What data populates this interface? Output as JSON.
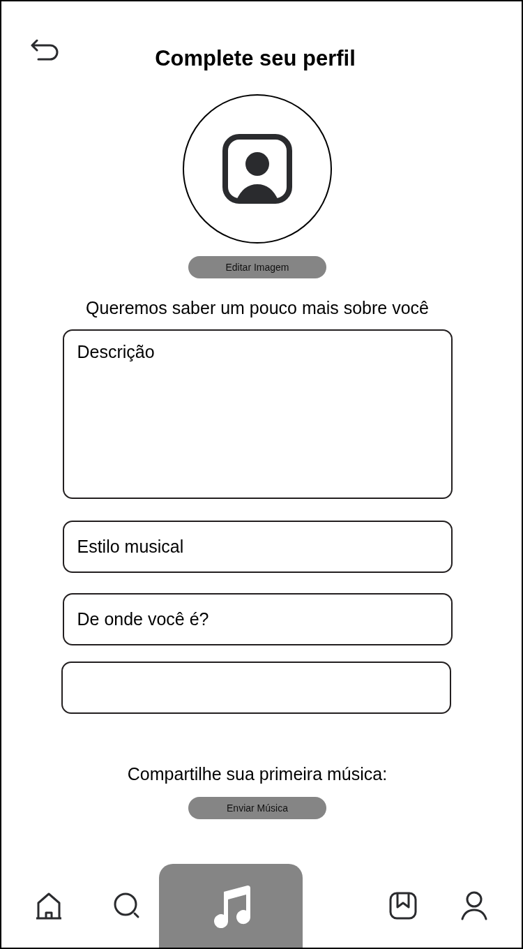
{
  "header": {
    "title": "Complete seu perfil"
  },
  "avatar": {
    "button": "Editar Imagem"
  },
  "intro": "Queremos saber um pouco mais sobre você",
  "fields": [
    {
      "kind": "textarea",
      "placeholder": "Descrição"
    },
    {
      "kind": "input",
      "placeholder": "Estilo musical"
    },
    {
      "kind": "input",
      "placeholder": "De onde você é?"
    },
    {
      "kind": "input"
    }
  ],
  "share": {
    "label": "Compartilhe sua primeira música:",
    "button": "Enviar Música"
  },
  "nav": [
    {
      "kind": "home",
      "selected": false
    },
    {
      "kind": "search",
      "selected": false
    },
    {
      "kind": "music",
      "selected": true
    },
    {
      "kind": "bookmark",
      "selected": false
    },
    {
      "kind": "profile",
      "selected": false
    }
  ]
}
